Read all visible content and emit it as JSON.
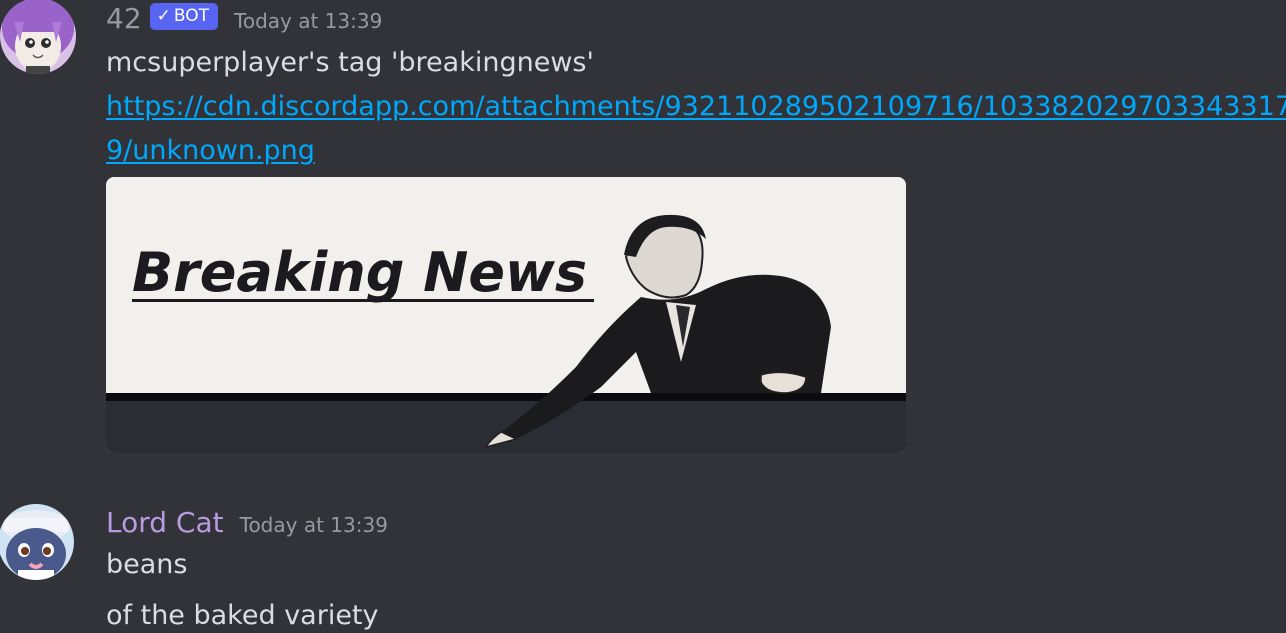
{
  "messages": [
    {
      "author": "42",
      "badge": "BOT",
      "timestamp": "Today at 13:39",
      "lines": [
        "mcsuperplayer's tag 'breakingnews'"
      ],
      "link_lines": [
        "https://cdn.discordapp.com/attachments/932110289502109716/103382029703343317",
        "9/unknown.png"
      ],
      "attachment": {
        "title_text": "Breaking News",
        "icon": "breaking-news-image"
      }
    },
    {
      "author": "Lord Cat",
      "timestamp": "Today at 13:39",
      "lines": [
        "beans",
        "of the baked variety"
      ]
    }
  ],
  "colors": {
    "background": "#313338",
    "text": "#dbdee1",
    "muted": "#949ba4",
    "link": "#00a8fc",
    "bot_badge": "#5865f2",
    "lordcat_name": "#b79be0"
  }
}
